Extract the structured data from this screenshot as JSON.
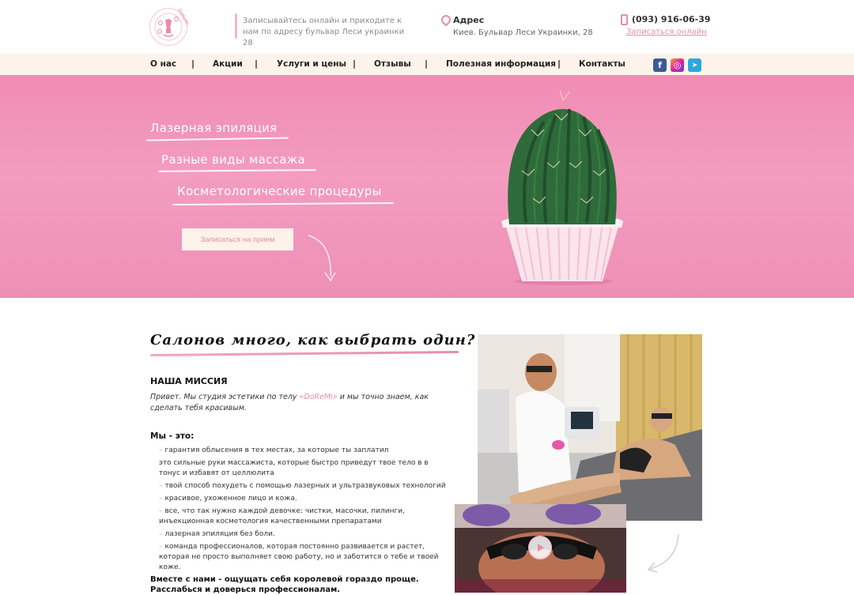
{
  "header": {
    "logo_text": "DoReMi",
    "tagline": "Записывайтесь онлайн и приходите к нам по адресу бульвар Леси украинки 28",
    "address_title": "Адрес",
    "address_line": "Киев. Бульвар Леси Украинки,  28",
    "phone": "(093) 916-06-39",
    "online_link": "Записаться онлайн"
  },
  "nav": {
    "items": [
      "О нас",
      "Акции",
      "Услуги и цены",
      "Отзывы",
      "Полезная информация",
      "Контакты"
    ],
    "separator": "|"
  },
  "social": {
    "facebook": "f",
    "instagram": "◎",
    "telegram": "➤"
  },
  "hero": {
    "line1": "Лазерная эпиляция",
    "line2": "Разные виды массажа",
    "line3": "Косметологические процедуры",
    "cta": "Записаться на прием"
  },
  "main": {
    "title": "Салонов много, как выбрать один?",
    "mission_heading": "НАША МИССИЯ",
    "mission_text_before": "Привет. Мы студия эстетики по телу ",
    "mission_brand": "«DoReMi»",
    "mission_text_after": " и мы точно знаем, как сделать тебя красивым.",
    "we_heading": "Мы - это:",
    "list": [
      "гарантия облысения в тех местах, за которые ты заплатил",
      "это сильные руки массажиста, которые быстро приведут твое тело в в тонус и избавят от целлюлита",
      "твой способ похудеть с помощью лазерных и ультразвуковых технологий",
      "красивое, ухоженное лицо и кожа.",
      "все, что так нужно каждой девочке: чистки, масочки, пилинги, инъекционная косметология качественными препаратами",
      "лазерная эпиляция без боли.",
      "команда профессионалов, которая постоянно развивается и растет, которая не просто выполняет свою работу, но и заботится о тебе и твоей коже."
    ],
    "list_has_dash": [
      true,
      false,
      true,
      true,
      true,
      true,
      true
    ],
    "closing_line1": "Вместе с нами - ощущать себя королевой гораздо проще.",
    "closing_line2": "Расслабься и доверься профессионалам."
  },
  "colors": {
    "accent": "#e78cab",
    "hero_pink": "#f39cc0",
    "nav_bg": "#fdf3ea"
  }
}
